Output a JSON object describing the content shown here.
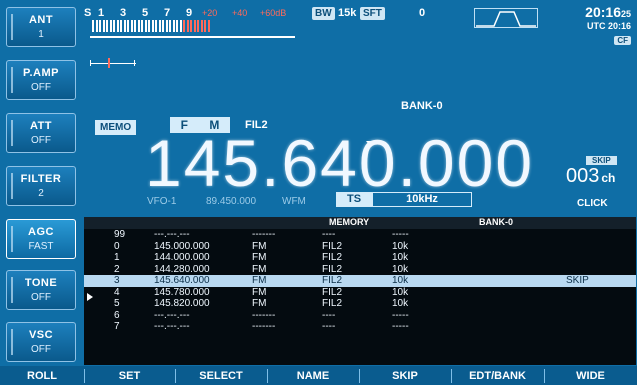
{
  "side_keys": [
    {
      "name": "ANT",
      "value": "1"
    },
    {
      "name": "P.AMP",
      "value": "OFF"
    },
    {
      "name": "ATT",
      "value": "OFF"
    },
    {
      "name": "FILTER",
      "value": "2"
    },
    {
      "name": "AGC",
      "value": "FAST"
    },
    {
      "name": "TONE",
      "value": "OFF"
    },
    {
      "name": "VSC",
      "value": "OFF"
    }
  ],
  "meter": {
    "s_label": "S",
    "scale": [
      "1",
      "3",
      "5",
      "7",
      "9",
      "+20",
      "+40",
      "+60dB"
    ]
  },
  "bw": {
    "label": "BW",
    "value": "15k"
  },
  "sft": {
    "label": "SFT",
    "value": "0"
  },
  "clock": {
    "time": "20:16",
    "seconds": "25",
    "utc": "UTC 20:16",
    "cf": "CF"
  },
  "memo_label": "MEMO",
  "mode": [
    "F",
    "M"
  ],
  "fil": "FIL2",
  "bank_top": "BANK-0",
  "frequency": "145.640.000",
  "skip_badge": "SKIP",
  "channel": {
    "number": "003",
    "unit": "ch"
  },
  "click": "CLICK",
  "sub": {
    "vfo": "VFO-1",
    "sub_freq": "89.450.000",
    "sub_mode": "WFM",
    "ts_label": "TS",
    "ts_value": "10kHz"
  },
  "memory": {
    "title": "MEMORY",
    "bank": "BANK-0",
    "rows": [
      {
        "ch": "99",
        "freq": "---.---.---",
        "mode": "-------",
        "fil": "----",
        "step": "-----",
        "skip": ""
      },
      {
        "ch": "0",
        "freq": "145.000.000",
        "mode": "FM",
        "fil": "FIL2",
        "step": "10k",
        "skip": ""
      },
      {
        "ch": "1",
        "freq": "144.000.000",
        "mode": "FM",
        "fil": "FIL2",
        "step": "10k",
        "skip": ""
      },
      {
        "ch": "2",
        "freq": "144.280.000",
        "mode": "FM",
        "fil": "FIL2",
        "step": "10k",
        "skip": ""
      },
      {
        "ch": "3",
        "freq": "145.640.000",
        "mode": "FM",
        "fil": "FIL2",
        "step": "10k",
        "skip": "SKIP"
      },
      {
        "ch": "4",
        "freq": "145.780.000",
        "mode": "FM",
        "fil": "FIL2",
        "step": "10k",
        "skip": ""
      },
      {
        "ch": "5",
        "freq": "145.820.000",
        "mode": "FM",
        "fil": "FIL2",
        "step": "10k",
        "skip": ""
      },
      {
        "ch": "6",
        "freq": "---.---.---",
        "mode": "-------",
        "fil": "----",
        "step": "-----",
        "skip": ""
      },
      {
        "ch": "7",
        "freq": "---.---.---",
        "mode": "-------",
        "fil": "----",
        "step": "-----",
        "skip": ""
      }
    ]
  },
  "softkeys": [
    "ROLL",
    "SET",
    "SELECT",
    "NAME",
    "SKIP",
    "EDT/BANK",
    "WIDE"
  ],
  "colors": {
    "background": "#0f6ea6",
    "selected_row": "#b9d9f1",
    "meter_red": "#ff6a5a"
  }
}
